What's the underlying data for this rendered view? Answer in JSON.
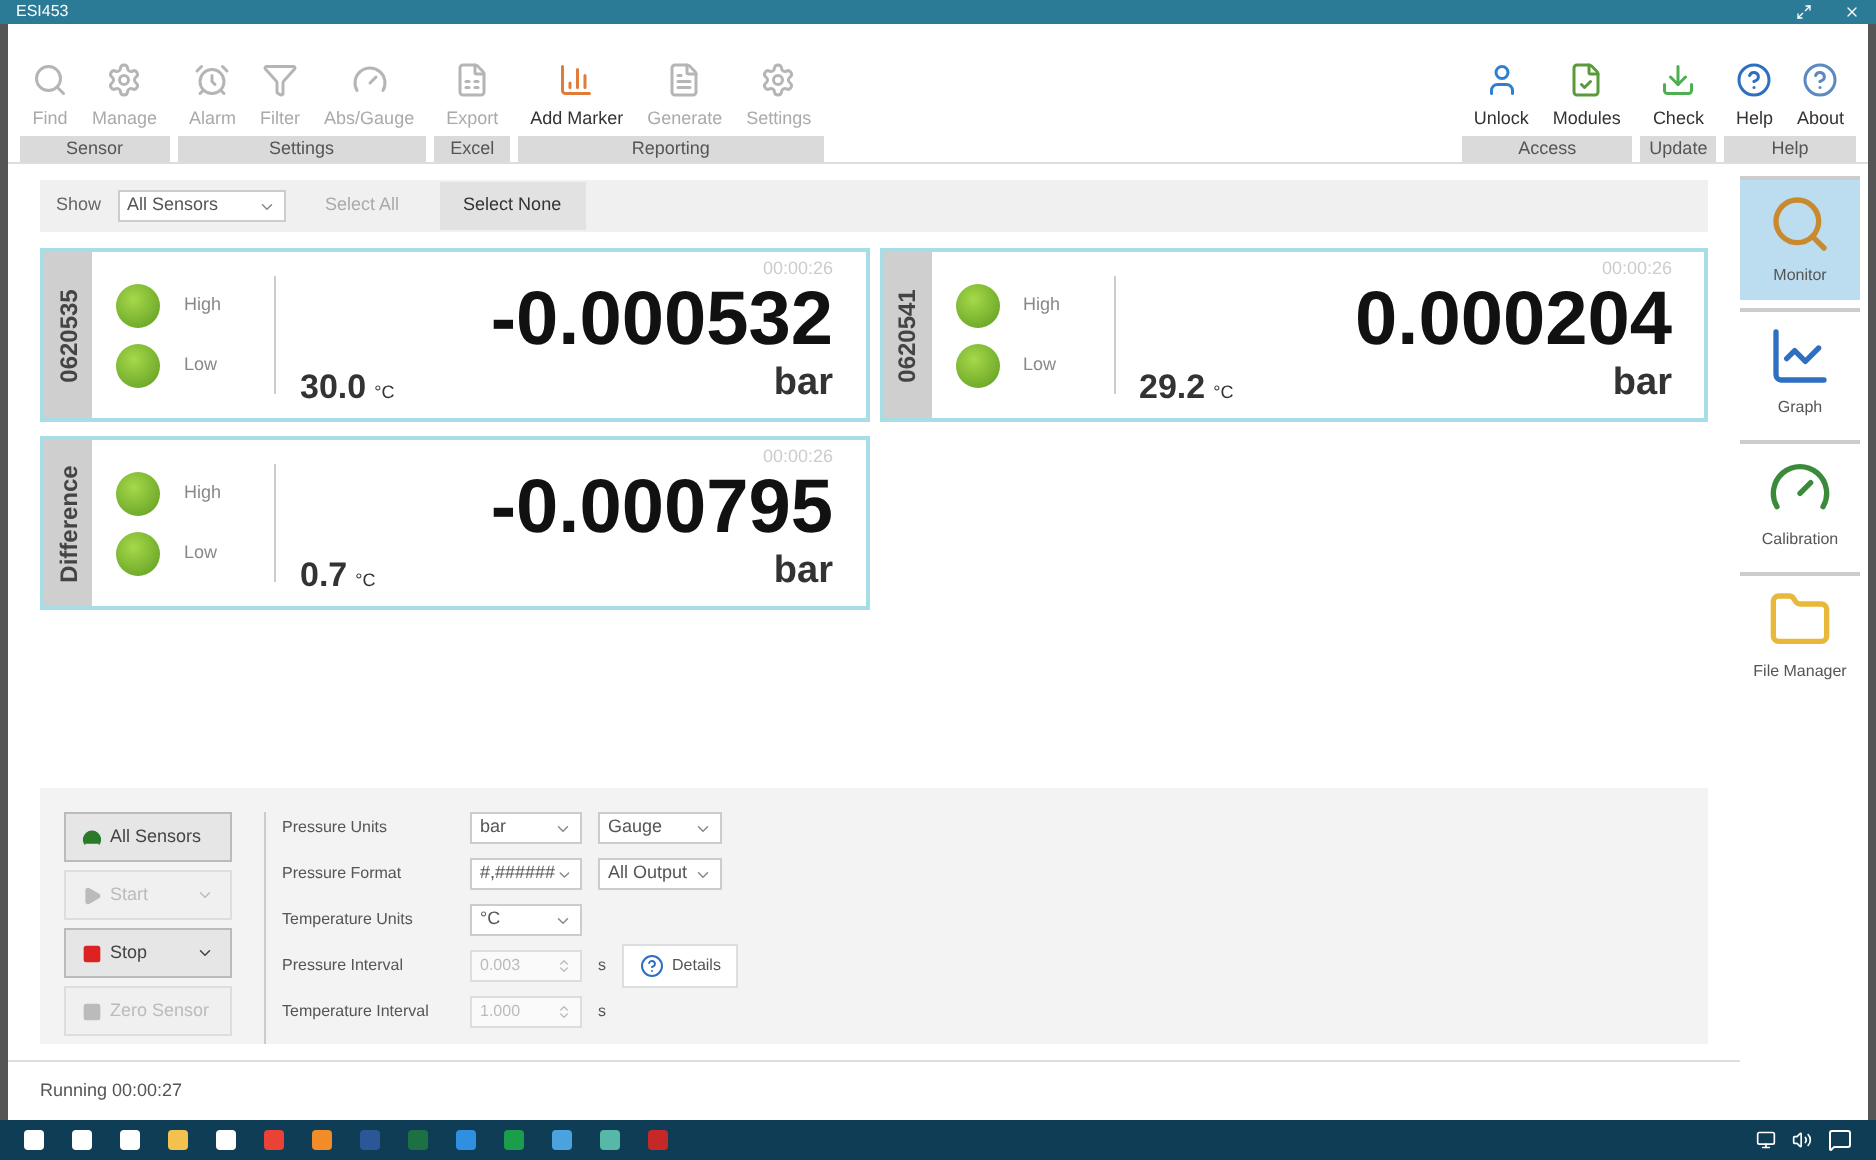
{
  "window": {
    "title": "ESI453"
  },
  "ribbon": {
    "left_groups": [
      {
        "label": "Sensor",
        "items": [
          {
            "label": "Find",
            "enabled": false
          },
          {
            "label": "Manage",
            "enabled": false
          }
        ]
      },
      {
        "label": "Settings",
        "items": [
          {
            "label": "Alarm",
            "enabled": false
          },
          {
            "label": "Filter",
            "enabled": false
          },
          {
            "label": "Abs/Gauge",
            "enabled": false
          }
        ]
      },
      {
        "label": "Excel",
        "items": [
          {
            "label": "Export",
            "enabled": false
          }
        ]
      },
      {
        "label": "Reporting",
        "items": [
          {
            "label": "Add Marker",
            "enabled": true
          },
          {
            "label": "Generate",
            "enabled": false
          },
          {
            "label": "Settings",
            "enabled": false
          }
        ]
      }
    ],
    "right_groups": [
      {
        "label": "Access",
        "items": [
          {
            "label": "Unlock",
            "enabled": true
          },
          {
            "label": "Modules",
            "enabled": true
          }
        ]
      },
      {
        "label": "Update",
        "items": [
          {
            "label": "Check",
            "enabled": true
          }
        ]
      },
      {
        "label": "Help",
        "items": [
          {
            "label": "Help",
            "enabled": true
          },
          {
            "label": "About",
            "enabled": true
          }
        ]
      }
    ]
  },
  "filter_bar": {
    "show_label": "Show",
    "show_value": "All Sensors",
    "buttons": [
      {
        "label": "Select All",
        "enabled": false
      },
      {
        "label": "Select None",
        "enabled": true
      }
    ]
  },
  "sensors": [
    {
      "name": "0620535",
      "time": "00:00:26",
      "alarms": [
        {
          "label": "High",
          "on": true
        },
        {
          "label": "Low",
          "on": true
        }
      ],
      "temperature": "30.0",
      "temp_unit": "°C",
      "value": "-0.000532",
      "unit": "bar"
    },
    {
      "name": "0620541",
      "time": "00:00:26",
      "alarms": [
        {
          "label": "High",
          "on": true
        },
        {
          "label": "Low",
          "on": true
        }
      ],
      "temperature": "29.2",
      "temp_unit": "°C",
      "value": "0.000204",
      "unit": "bar"
    },
    {
      "name": "Difference",
      "time": "00:00:26",
      "alarms": [
        {
          "label": "High",
          "on": true
        },
        {
          "label": "Low",
          "on": true
        }
      ],
      "temperature": "0.7",
      "temp_unit": "°C",
      "value": "-0.000795",
      "unit": "bar"
    }
  ],
  "side_nav": [
    {
      "label": "Monitor",
      "selected": true
    },
    {
      "label": "Graph",
      "selected": false
    },
    {
      "label": "Calibration",
      "selected": false
    },
    {
      "label": "File Manager",
      "selected": false
    }
  ],
  "controls": [
    {
      "label": "All Sensors",
      "enabled": true
    },
    {
      "label": "Start",
      "enabled": false,
      "dropdown": true
    },
    {
      "label": "Stop",
      "enabled": true,
      "dropdown": true
    },
    {
      "label": "Zero Sensor",
      "enabled": false
    }
  ],
  "settings": [
    {
      "label": "Pressure Units",
      "kind": "select",
      "value": "bar",
      "extra": "Gauge"
    },
    {
      "label": "Pressure Format",
      "kind": "select",
      "value": "#,######",
      "extra": "All Output"
    },
    {
      "label": "Temperature Units",
      "kind": "select",
      "value": "°C"
    },
    {
      "label": "Pressure Interval",
      "kind": "spin",
      "disabled": true,
      "value": "0.003",
      "unit": "s",
      "button": "Details"
    },
    {
      "label": "Temperature Interval",
      "kind": "spin",
      "disabled": true,
      "value": "1.000",
      "unit": "s"
    }
  ],
  "status_bar": {
    "text": "Running 00:00:27"
  }
}
